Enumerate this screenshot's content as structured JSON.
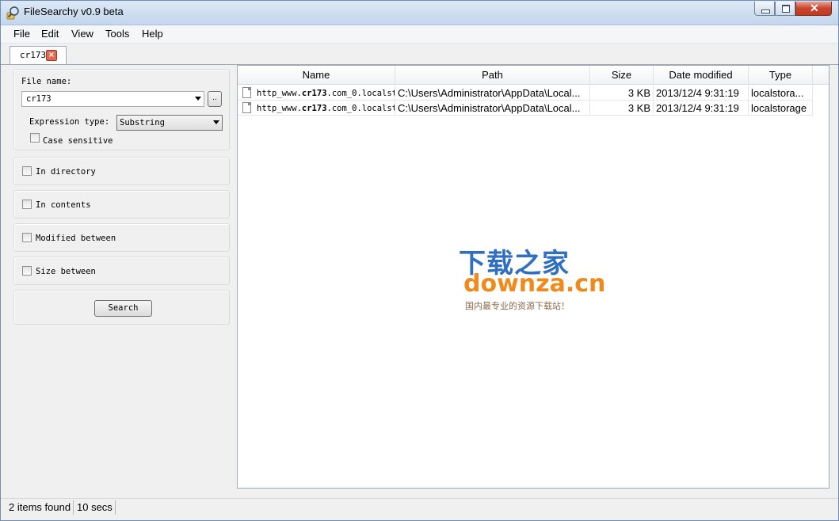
{
  "window": {
    "title": "FileSearchy v0.9 beta"
  },
  "menu": {
    "items": [
      "File",
      "Edit",
      "View",
      "Tools",
      "Help"
    ]
  },
  "tab": {
    "label": "cr173",
    "close_glyph": "×"
  },
  "search": {
    "file_name_label": "File name:",
    "file_name_value": "cr173",
    "browse_label": "..",
    "expression_type_label": "Expression type:",
    "expression_type_value": "Substring",
    "case_sensitive_label": "Case sensitive",
    "in_directory_label": "In directory",
    "in_contents_label": "In contents",
    "modified_between_label": "Modified between",
    "size_between_label": "Size between",
    "search_button": "Search"
  },
  "table": {
    "columns": [
      "Name",
      "Path",
      "Size",
      "Date modified",
      "Type"
    ],
    "rows": [
      {
        "name_pre": "http_www.",
        "name_bold": "cr173",
        "name_post": ".com_0.localst",
        "path": "C:\\Users\\Administrator\\AppData\\Local...",
        "size": "3 KB",
        "date": "2013/12/4 9:31:19",
        "type": "localstora..."
      },
      {
        "name_pre": "http_www.",
        "name_bold": "cr173",
        "name_post": ".com_0.localst",
        "path": "C:\\Users\\Administrator\\AppData\\Local...",
        "size": "3 KB",
        "date": "2013/12/4 9:31:19",
        "type": "localstorage"
      }
    ]
  },
  "watermark": {
    "line1": "下载之家",
    "line2": "downza.cn",
    "line3": "国内最专业的资源下载站！"
  },
  "status": {
    "items_found": "2 items found",
    "time": "10 secs"
  },
  "icons": {
    "app": "magnifier-icon",
    "file": "file-icon",
    "tab_close": "close-icon"
  },
  "colors": {
    "tab_close": "#e06b50",
    "window_close": "#c7452e",
    "watermark_blue": "#2f6fc2",
    "watermark_orange": "#f08a1c"
  }
}
